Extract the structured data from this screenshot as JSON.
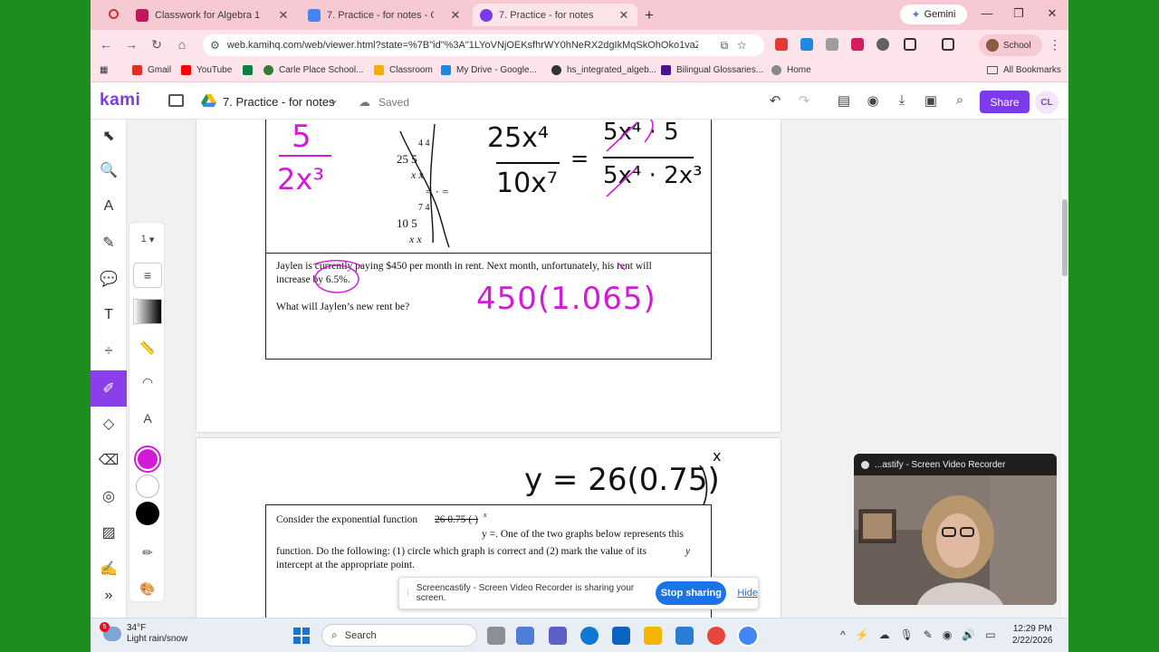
{
  "browser": {
    "tabs": [
      {
        "label": "Classwork for Algebra 1 - Perio",
        "icon": "classroom-icon",
        "color": "#c2185b",
        "active": false
      },
      {
        "label": "7. Practice - for notes - Google",
        "icon": "google-docs-icon",
        "color": "#4285f4",
        "active": false
      },
      {
        "label": "7. Practice - for notes",
        "icon": "kami-icon",
        "color": "#7c3aed",
        "active": true
      }
    ],
    "new_tab": "+",
    "gemini_label": "Gemini",
    "url": "web.kamihq.com/web/viewer.html?state=%7B\"id\"%3A\"1LYoVNjOEKsfhrWY0hNeRX2dgIkMqSkOhOko1vaZ...",
    "profile_label": "School",
    "bookmarks": [
      {
        "label": "Gmail",
        "color": "#d93025"
      },
      {
        "label": "YouTube",
        "color": "#ff0000"
      },
      {
        "label": "",
        "color": "#0b8043"
      },
      {
        "label": "Carle Place School...",
        "color": "#2e7d32"
      },
      {
        "label": "Classroom",
        "color": "#f9ab00"
      },
      {
        "label": "My Drive - Google...",
        "color": "#1e88e5"
      },
      {
        "label": "hs_integrated_algeb...",
        "color": "#333333"
      },
      {
        "label": "Bilingual Glossaries...",
        "color": "#4a148c"
      },
      {
        "label": "Home",
        "color": "#888888"
      }
    ],
    "all_bookmarks": "All Bookmarks"
  },
  "kami": {
    "logo": "kami",
    "doc_title": "7. Practice - for notes",
    "saved_status": "Saved",
    "share_label": "Share",
    "avatar_initials": "CL",
    "accent": "#7c3aed",
    "page_number": "1",
    "ink_color": "#d21ad8"
  },
  "document": {
    "q_frac": {
      "top_left": "4 4",
      "top_mid": "25 5",
      "top_vars": "x x",
      "equals": "= · =",
      "bot_left": "7 4",
      "bot_mid": "10 5",
      "bot_vars": "x x"
    },
    "q_rent": {
      "line1": "Jaylen is currently paying $450 per month in rent. Next month, unfortunately, his rent will",
      "line2": "increase by 6.5%.",
      "question": "What will Jaylen’s new rent be?"
    },
    "q_exp": {
      "line1a": "Consider the exponential function",
      "struck": "26 0.75 ( )",
      "exp": "x",
      "line1b": "y =. One of the two graphs below represents this",
      "line2": "function. Do the following: (1) circle which graph is correct and (2) mark the value of its",
      "y_var": "y",
      "line3": "intercept at the appropriate point."
    },
    "handwriting": {
      "ans_frac_num": "5",
      "ans_frac_den": "2x³",
      "work_num": "25x⁴",
      "work_den": "10x⁷",
      "work_eq": "=",
      "work_factored_num": "5x⁴ · 5",
      "work_factored_den": "5x⁴ · 2x³",
      "rent_expr": "450(1.065)",
      "exp_expr": "y = 26(0.75)",
      "exp_power": "x"
    }
  },
  "recorder": {
    "title": "...astify - Screen Video Recorder",
    "share_message": "Screencastify - Screen Video Recorder is sharing your screen.",
    "stop_label": "Stop sharing",
    "hide_label": "Hide"
  },
  "taskbar": {
    "weather_badge": "5",
    "temp": "34°F",
    "condition": "Light rain/snow",
    "search_placeholder": "Search",
    "time": "12:29 PM",
    "date": "2/22/2026"
  }
}
